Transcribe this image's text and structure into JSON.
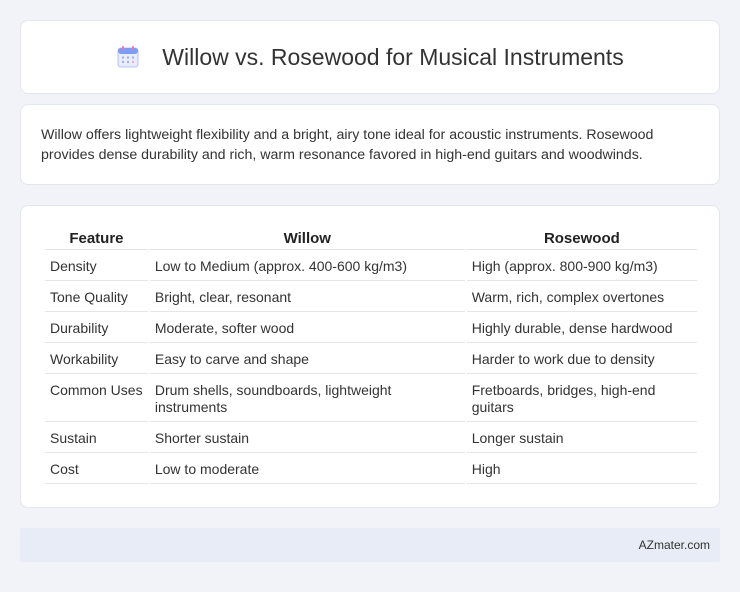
{
  "header": {
    "title": "Willow vs. Rosewood for Musical Instruments",
    "icon": "calendar-icon"
  },
  "summary": {
    "text": "Willow offers lightweight flexibility and a bright, airy tone ideal for acoustic instruments. Rosewood provides dense durability and rich, warm resonance favored in high-end guitars and woodwinds."
  },
  "table": {
    "headers": [
      "Feature",
      "Willow",
      "Rosewood"
    ],
    "rows": [
      [
        "Density",
        "Low to Medium (approx. 400-600 kg/m3)",
        "High (approx. 800-900 kg/m3)"
      ],
      [
        "Tone Quality",
        "Bright, clear, resonant",
        "Warm, rich, complex overtones"
      ],
      [
        "Durability",
        "Moderate, softer wood",
        "Highly durable, dense hardwood"
      ],
      [
        "Workability",
        "Easy to carve and shape",
        "Harder to work due to density"
      ],
      [
        "Common Uses",
        "Drum shells, soundboards, lightweight instruments",
        "Fretboards, bridges, high-end guitars"
      ],
      [
        "Sustain",
        "Shorter sustain",
        "Longer sustain"
      ],
      [
        "Cost",
        "Low to moderate",
        "High"
      ]
    ]
  },
  "footer": {
    "text": "AZmater.com"
  },
  "colors": {
    "background": "#f1f3f8",
    "footer_bg": "#e7ecf6",
    "icon_accent": "#6b8df5"
  }
}
